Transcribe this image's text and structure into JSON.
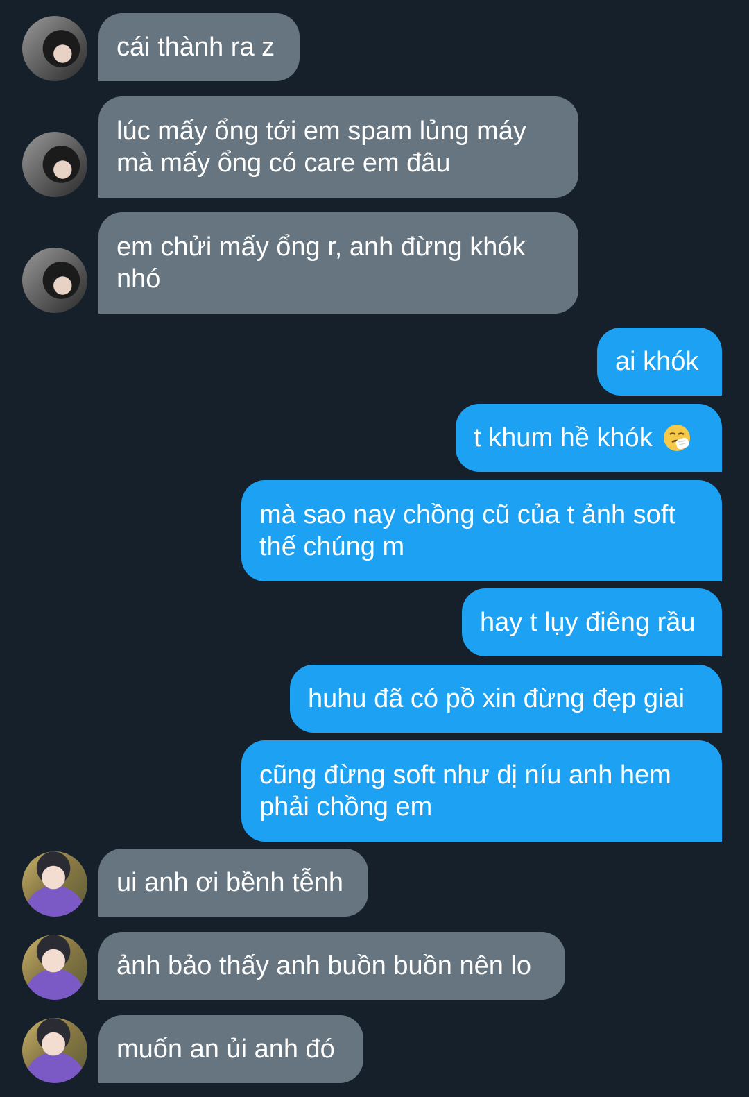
{
  "colors": {
    "background": "#15202b",
    "received_bubble": "#66757f",
    "sent_bubble": "#1da1f2",
    "text": "#ffffff"
  },
  "messages": [
    {
      "side": "received",
      "avatar": "hooded-person-avatar",
      "text": "cái thành ra z"
    },
    {
      "side": "received",
      "avatar": "hooded-person-avatar",
      "text": "lúc mấy ổng tới em spam lủng máy\nmà mấy ổng có care em đâu"
    },
    {
      "side": "received",
      "avatar": "hooded-person-avatar",
      "text": "em chửi mấy ổng r, anh đừng khók\nnhó"
    },
    {
      "side": "sent",
      "text": "ai khók"
    },
    {
      "side": "sent",
      "text": "t khum hề khók",
      "icon": "sneezing-face-emoji"
    },
    {
      "side": "sent",
      "text": "mà sao nay chồng cũ của t ảnh soft\nthế chúng m"
    },
    {
      "side": "sent",
      "text": "hay t lụy điêng rầu"
    },
    {
      "side": "sent",
      "text": "huhu đã có pồ xin đừng đẹp giai"
    },
    {
      "side": "sent",
      "text": "cũng đừng soft như dị níu anh hem\nphải chồng em"
    },
    {
      "side": "received",
      "avatar": "purple-shirt-person-avatar",
      "text": "ui anh ơi bềnh tễnh"
    },
    {
      "side": "received",
      "avatar": "purple-shirt-person-avatar",
      "text": "ảnh bảo thấy anh buồn buồn nên lo"
    },
    {
      "side": "received",
      "avatar": "purple-shirt-person-avatar",
      "text": "muốn an ủi anh đó"
    }
  ]
}
